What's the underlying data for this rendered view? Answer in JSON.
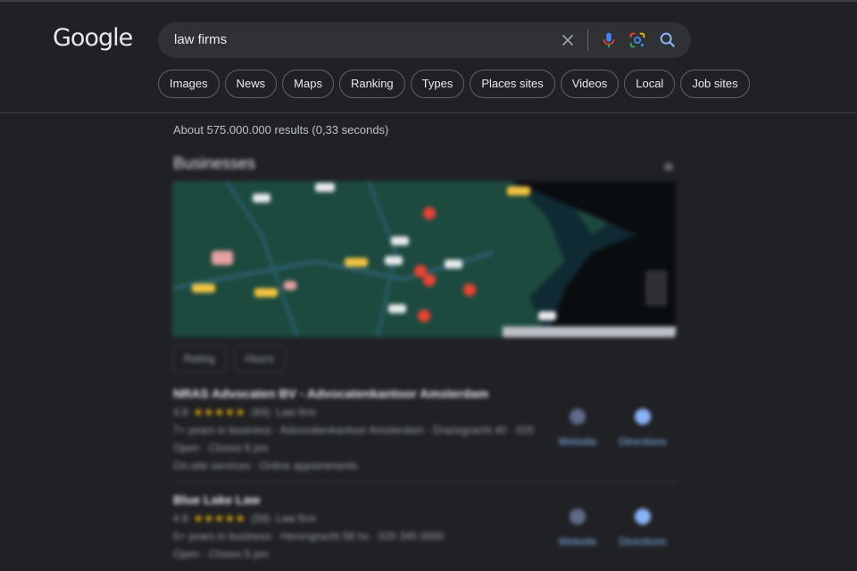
{
  "logo": "Google",
  "search": {
    "query": "law firms"
  },
  "chips": [
    "Images",
    "News",
    "Maps",
    "Ranking",
    "Types",
    "Places sites",
    "Videos",
    "Local",
    "Job sites"
  ],
  "result_stats": "About 575.000.000 results (0,33 seconds)",
  "businesses": {
    "title": "Businesses",
    "filters": [
      "Rating",
      "Hours"
    ],
    "listings": [
      {
        "name": "NRAS Advocaten BV - Advocatenkantoor Amsterdam",
        "rating": "4.8",
        "reviews": "(64)",
        "type": "Law firm",
        "line1": "7+ years in business · Advocatenkantoor Amsterdam · Drazegracht 40 · 020",
        "line2": "Open · Closes 6 pm",
        "line3": "On-site services · Online appointments",
        "website_label": "Website",
        "directions_label": "Directions"
      },
      {
        "name": "Blue Lake Law",
        "rating": "4.9",
        "reviews": "(58)",
        "type": "Law firm",
        "line1": "5+ years in business · Herengracht 58 hs · 020 345 0000",
        "line2": "Open · Closes 5 pm",
        "website_label": "Website",
        "directions_label": "Directions"
      }
    ]
  },
  "colors": {
    "background": "#202124",
    "searchbar": "#303134",
    "accent_link": "#8ab4f8",
    "map_water": "#0f2a33",
    "map_land": "#1d4a3e",
    "pin": "#ea4335"
  },
  "icons": [
    "clear-icon",
    "microphone-icon",
    "lens-icon",
    "search-icon"
  ]
}
